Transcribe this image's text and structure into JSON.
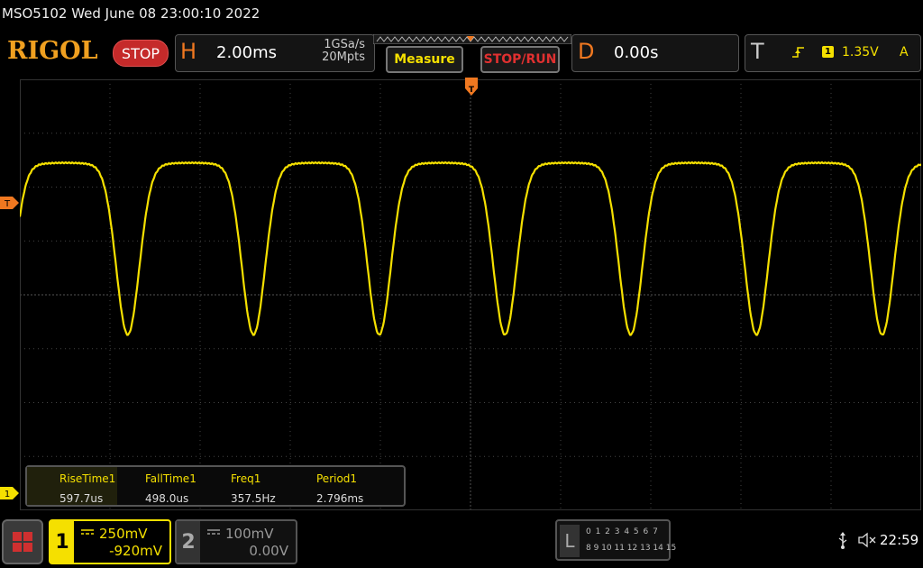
{
  "header": {
    "model_datetime": "MSO5102  Wed June 08 23:00:10 2022"
  },
  "toolbar": {
    "logo": "RIGOL",
    "run_state": "STOP",
    "horizontal": {
      "letter": "H",
      "timebase": "2.00ms",
      "sample_rate": "1GSa/s",
      "memory_depth": "20Mpts"
    },
    "measure_label": "Measure",
    "stoprun_label": "STOP/RUN",
    "delay": {
      "letter": "D",
      "value": "0.00s"
    },
    "trigger": {
      "letter": "T",
      "source": "1",
      "level": "1.35V",
      "mode": "A"
    }
  },
  "screen": {
    "trigger_marker": "T",
    "channel_marker": "1"
  },
  "measurements": [
    {
      "name": "RiseTime1",
      "value": "597.7us"
    },
    {
      "name": "FallTime1",
      "value": "498.0us"
    },
    {
      "name": "Freq1",
      "value": "357.5Hz"
    },
    {
      "name": "Period1",
      "value": "2.796ms"
    }
  ],
  "channels": [
    {
      "number": "1",
      "scale": "250mV",
      "offset": "-920mV",
      "active": true
    },
    {
      "number": "2",
      "scale": "100mV",
      "offset": "0.00V",
      "active": false
    }
  ],
  "logic_analyzer": {
    "letter": "L",
    "row1": "0 1 2 3  4 5 6 7",
    "row2": "8 9 10 11 12 13 14 15"
  },
  "status": {
    "clock": "22:59"
  },
  "colors": {
    "ch1": "#f5e000",
    "accent": "#f07820",
    "stop": "#c52a2a",
    "grid": "#444444"
  }
}
